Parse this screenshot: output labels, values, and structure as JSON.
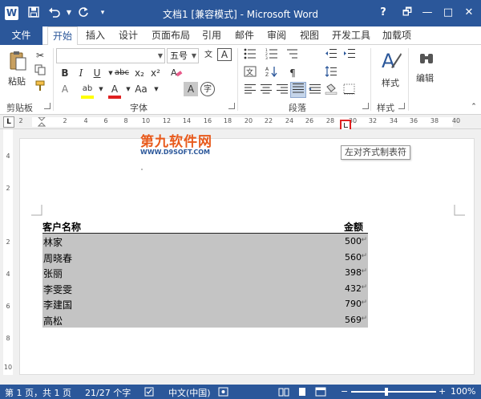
{
  "app": {
    "title": "文档1 [兼容模式] - Microsoft Word",
    "logo_letter": "W",
    "help": "?",
    "quick_access": {
      "save_icon": "save-icon",
      "undo_icon": "undo-icon",
      "redo_icon": "redo-icon",
      "customize_icon": "chevron-down-icon"
    },
    "window_controls": {
      "restore": "🗗",
      "minimize": "—",
      "maximize": "□",
      "close": "✕"
    }
  },
  "ribbon": {
    "file_tab": "文件",
    "tabs": [
      "开始",
      "插入",
      "设计",
      "页面布局",
      "引用",
      "邮件",
      "审阅",
      "视图",
      "开发工具",
      "加载项"
    ],
    "active_tab": "开始",
    "groups": {
      "clipboard": {
        "label": "剪贴板",
        "paste": "粘贴"
      },
      "font": {
        "label": "字体",
        "font_name": "",
        "font_size": "五号",
        "bold": "B",
        "italic": "I",
        "underline": "U",
        "strike": "abc",
        "subscript": "x₂",
        "superscript": "x²",
        "grow": "A",
        "shrink": "A",
        "case": "Aa",
        "phonetic": "文",
        "border_char": "A",
        "highlight": "ab",
        "color": "A",
        "shade": "A",
        "enclose": "字"
      },
      "paragraph": {
        "label": "段落"
      },
      "styles": {
        "label": "样式",
        "button": "样式"
      },
      "editing": {
        "label": "编辑",
        "button": "编辑"
      }
    }
  },
  "ruler": {
    "left_marker": "L",
    "marks": [
      "2",
      "2",
      "4",
      "6",
      "8",
      "10",
      "12",
      "14",
      "16",
      "18",
      "20",
      "22",
      "24",
      "26",
      "28",
      "30",
      "32",
      "34",
      "36",
      "38",
      "40"
    ],
    "vmarks": [
      "4",
      "2",
      "",
      "2",
      "4",
      "6",
      "8",
      "10"
    ]
  },
  "tooltip": "左对齐式制表符",
  "watermark": {
    "cn": "第九软件网",
    "en": "WWW.D9SOFT.COM"
  },
  "document": {
    "header": {
      "name": "客户名称",
      "amount": "金额"
    },
    "rows": [
      {
        "name": "林家",
        "amount": "500"
      },
      {
        "name": "周晓春",
        "amount": "560"
      },
      {
        "name": "张丽",
        "amount": "398"
      },
      {
        "name": "李雯雯",
        "amount": "432"
      },
      {
        "name": "李建国",
        "amount": "790"
      },
      {
        "name": "高松",
        "amount": "569"
      }
    ],
    "paragraph_mark": "↵"
  },
  "status": {
    "page": "第 1 页，共 1 页",
    "words": "21/27 个字",
    "language": "中文(中国)",
    "zoom": "100%",
    "zoom_minus": "−",
    "zoom_plus": "+"
  },
  "colors": {
    "accent": "#2b579a",
    "highlight": "#ffff00",
    "font_red": "#e02020",
    "selection": "#c4c4c4"
  }
}
